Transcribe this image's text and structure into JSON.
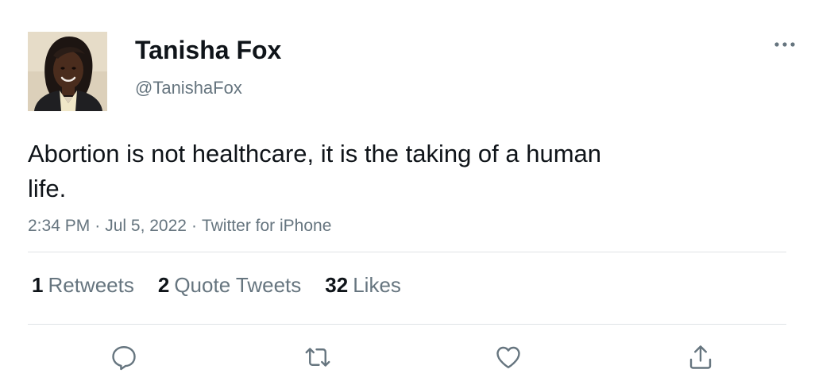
{
  "author": {
    "display_name": "Tanisha Fox",
    "handle": "@TanishaFox"
  },
  "tweet": {
    "text": "Abortion is not healthcare, it is the taking of a human life.",
    "time": "2:34 PM",
    "date": "Jul 5, 2022",
    "source": "Twitter for iPhone",
    "separator": "·"
  },
  "stats": {
    "retweets_count": "1",
    "retweets_label": "Retweets",
    "quotes_count": "2",
    "quotes_label": "Quote Tweets",
    "likes_count": "32",
    "likes_label": "Likes"
  },
  "icons": {
    "more": "more-icon",
    "reply": "reply-icon",
    "retweet": "retweet-icon",
    "like": "like-icon",
    "share": "share-icon"
  },
  "colors": {
    "text": "#0f1419",
    "secondary": "#66757f",
    "divider": "#dfe3e6",
    "icon": "#66757f"
  }
}
